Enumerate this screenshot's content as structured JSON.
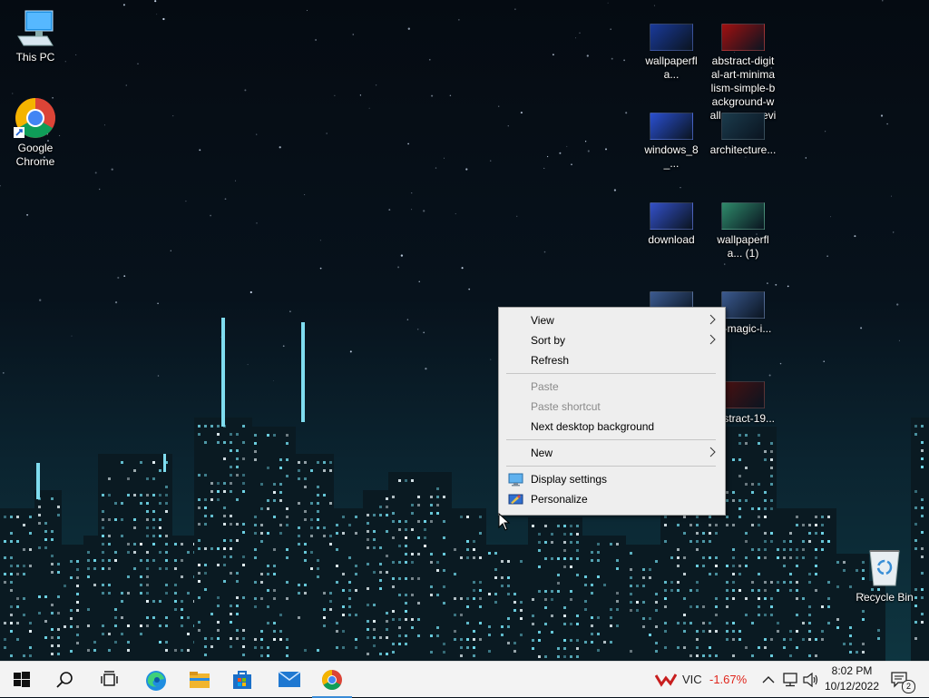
{
  "desktop": {
    "icons_left": [
      {
        "label": "This PC",
        "icon": "this-pc-icon"
      },
      {
        "label": "Google\nChrome",
        "icon": "chrome-icon"
      }
    ],
    "icons_right": [
      {
        "label": "wallpaperfla...",
        "thumb": "#1a3a9a"
      },
      {
        "label": "abstract-digit al-art-minima lism-simple-b ackground-w allpaper-previ ew",
        "thumb": "#a01010"
      },
      {
        "label": "windows_8_...",
        "thumb": "#2a4fd0"
      },
      {
        "label": "architecture...",
        "thumb": "#1b3b4c"
      },
      {
        "label": "download",
        "thumb": "#3350c8"
      },
      {
        "label": "wallpaperfla... (1)",
        "thumb": "#2e8a6a"
      },
      {
        "label": "...-magic-i...",
        "thumb": "#3b5a90"
      },
      {
        "label": "abstract-19...",
        "thumb": "#4a1010"
      }
    ],
    "recycle_bin": "Recycle Bin"
  },
  "context_menu": {
    "items": [
      {
        "label": "View",
        "submenu": true,
        "enabled": true
      },
      {
        "label": "Sort by",
        "submenu": true,
        "enabled": true
      },
      {
        "label": "Refresh",
        "submenu": false,
        "enabled": true
      },
      {
        "label": "Paste",
        "submenu": false,
        "enabled": false
      },
      {
        "label": "Paste shortcut",
        "submenu": false,
        "enabled": false
      },
      {
        "label": "Next desktop background",
        "submenu": false,
        "enabled": true
      },
      {
        "label": "New",
        "submenu": true,
        "enabled": true
      },
      {
        "label": "Display settings",
        "submenu": false,
        "enabled": true,
        "icon": "display-icon"
      },
      {
        "label": "Personalize",
        "submenu": false,
        "enabled": true,
        "icon": "personalize-icon"
      }
    ]
  },
  "taskbar": {
    "apps": [
      "start-icon",
      "search-icon",
      "task-view-icon",
      "edge-icon",
      "file-explorer-icon",
      "microsoft-store-icon",
      "mail-icon",
      "chrome-icon"
    ],
    "active_app": "chrome-icon",
    "stock": {
      "symbol": "VIC",
      "change": "-1.67%",
      "color": "#e0261c"
    },
    "clock": {
      "time": "8:02 PM",
      "date": "10/12/2022"
    },
    "notifications": "2"
  }
}
